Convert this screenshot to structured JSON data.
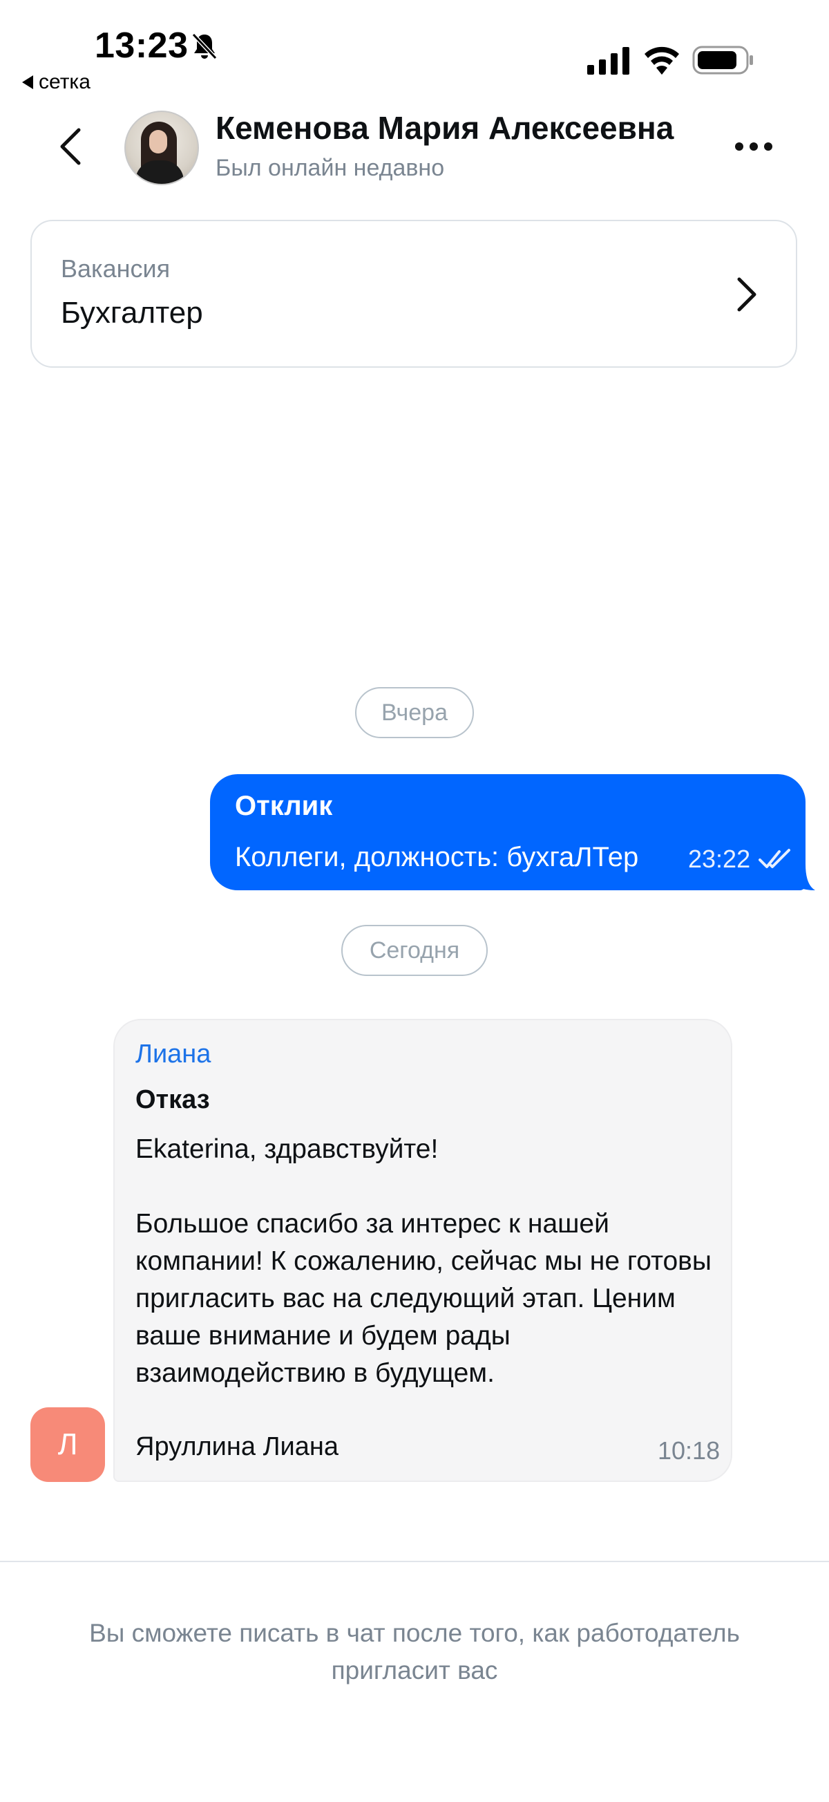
{
  "status_bar": {
    "time": "13:23",
    "back_app": "сетка"
  },
  "header": {
    "contact_name": "Кеменова Мария Алексеевна",
    "contact_status": "Был онлайн недавно"
  },
  "vacancy": {
    "label": "Вакансия",
    "title": "Бухгалтер"
  },
  "dates": {
    "yesterday": "Вчера",
    "today": "Сегодня"
  },
  "outgoing_message": {
    "type": "Отклик",
    "text": "Коллеги, должность: бухгаЛТер",
    "time": "23:22"
  },
  "incoming_message": {
    "author": "Лиана",
    "type": "Отказ",
    "paragraphs": [
      "Ekaterina, здравствуйте!",
      "Большое спасибо за интерес к нашей компании! К сожалению, сейчас мы не готовы пригласить вас на следующий этап. Ценим ваше внимание и будем рады взаимодействию в будущем."
    ],
    "signature": "Яруллина Лиана",
    "time": "10:18",
    "sender_initial": "Л"
  },
  "footer": {
    "note": "Вы сможете писать в чат после того, как работодатель пригласит вас"
  },
  "colors": {
    "accent": "#0166ff",
    "author_link": "#1d73e8",
    "sender_avatar": "#f78a78",
    "muted_text": "#7a8591"
  },
  "icons": [
    "bell-slash-icon",
    "signal-icon",
    "wifi-icon",
    "battery-icon",
    "back-arrow-icon",
    "more-icon",
    "chevron-right-icon",
    "double-check-icon"
  ]
}
